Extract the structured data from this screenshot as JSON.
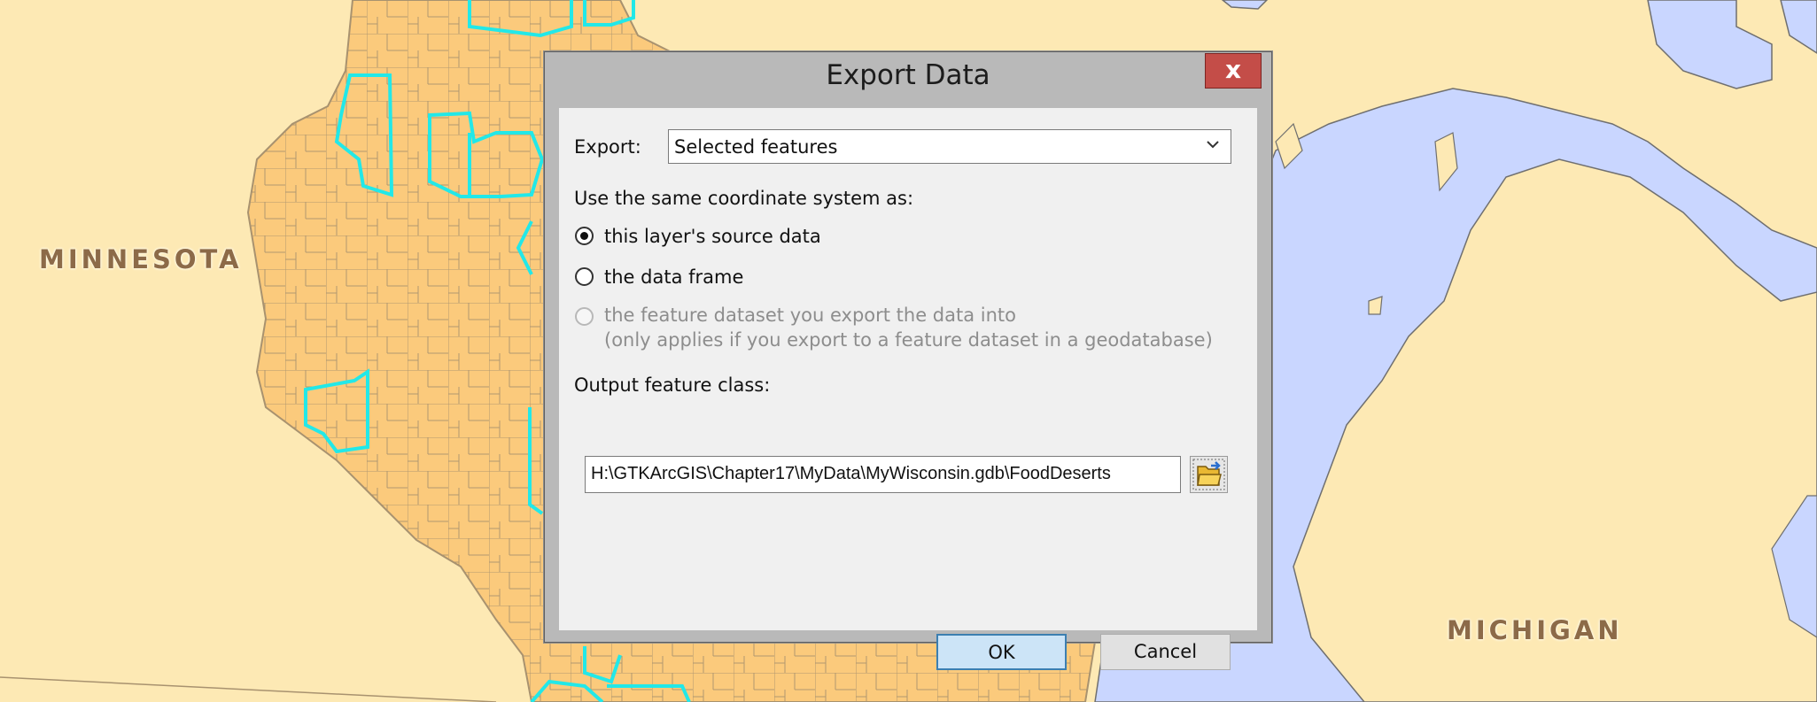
{
  "map": {
    "labels": {
      "minnesota": "MINNESOTA",
      "michigan": "MICHIGAN"
    },
    "colors": {
      "background_land": "#fde9b4",
      "wisconsin_fill": "#fbca7c",
      "county_lines": "#a8926f",
      "selection_outline": "#22e8e8",
      "water": "#c9d6ff"
    }
  },
  "dialog": {
    "title": "Export Data",
    "close_label": "x",
    "export_label": "Export:",
    "export_value": "Selected features",
    "coord_heading": "Use the same coordinate system as:",
    "options": [
      {
        "label": "this layer's source data",
        "checked": true,
        "enabled": true
      },
      {
        "label": "the data frame",
        "checked": false,
        "enabled": true
      },
      {
        "label": "the feature dataset you export the data into",
        "note": "(only applies if you export to a feature dataset in a geodatabase)",
        "checked": false,
        "enabled": false
      }
    ],
    "output_label": "Output feature class:",
    "output_value": "H:\\GTKArcGIS\\Chapter17\\MyData\\MyWisconsin.gdb\\FoodDeserts",
    "ok_label": "OK",
    "cancel_label": "Cancel",
    "browse_icon": "folder-browse-icon"
  }
}
